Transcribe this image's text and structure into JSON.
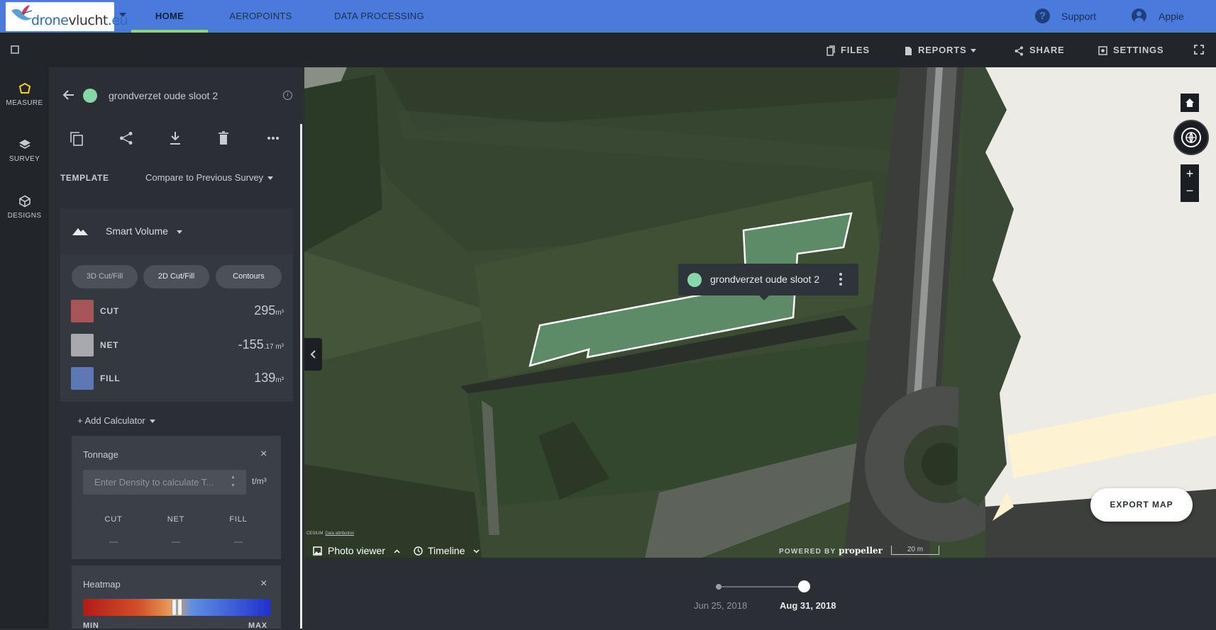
{
  "brand": {
    "logo_prefix": "drone",
    "logo_suffix": "vlucht",
    "logo_tld": ".eu"
  },
  "nav": {
    "tabs": [
      {
        "label": "HOME"
      },
      {
        "label": "AEROPOINTS"
      },
      {
        "label": "DATA PROCESSING"
      }
    ],
    "support_label": "Support",
    "user_name": "Appie"
  },
  "toolbar": {
    "files": "FILES",
    "reports": "REPORTS",
    "share": "SHARE",
    "settings": "SETTINGS"
  },
  "rail": {
    "items": [
      {
        "label": "MEASURE",
        "icon": "polygon-icon"
      },
      {
        "label": "SURVEY",
        "icon": "layers-icon"
      },
      {
        "label": "DESIGNS",
        "icon": "cube-icon"
      }
    ]
  },
  "measurement": {
    "title": "grondverzet oude sloot 2",
    "color": "#86d8a9",
    "template_label": "TEMPLATE",
    "template_value": "Compare to Previous Survey",
    "tool_label": "Smart Volume",
    "modes": [
      "3D Cut/Fill",
      "2D Cut/Fill",
      "Contours"
    ],
    "volumes": [
      {
        "name": "CUT",
        "value": "295",
        "decimals": "",
        "unit": "m³",
        "color": "#a8555a"
      },
      {
        "name": "NET",
        "value": "-155",
        "decimals": ".17",
        "unit": " m³",
        "color": "#a7a9ad"
      },
      {
        "name": "FILL",
        "value": "139",
        "decimals": "",
        "unit": "m³",
        "color": "#5d78b4"
      }
    ],
    "add_calculator": "+ Add Calculator",
    "tonnage": {
      "title": "Tonnage",
      "placeholder": "Enter Density to calculate T...",
      "unit": "t/m³",
      "cols": [
        {
          "label": "CUT",
          "value": "—"
        },
        {
          "label": "NET",
          "value": "—"
        },
        {
          "label": "FILL",
          "value": "—"
        }
      ]
    },
    "heatmap": {
      "title": "Heatmap",
      "min_label": "MIN",
      "max_label": "MAX"
    }
  },
  "map": {
    "popup_label": "grondverzet oude sloot 2",
    "export_label": "EXPORT MAP",
    "attribution": "CESIUM",
    "attribution_link": "Data attribution",
    "photo_viewer": "Photo viewer",
    "timeline": "Timeline",
    "powered_by": "POWERED BY",
    "powered_brand": "propeller",
    "scale": "20 m"
  },
  "timeline": {
    "dates": [
      "Jun 25, 2018",
      "Aug 31, 2018"
    ]
  }
}
